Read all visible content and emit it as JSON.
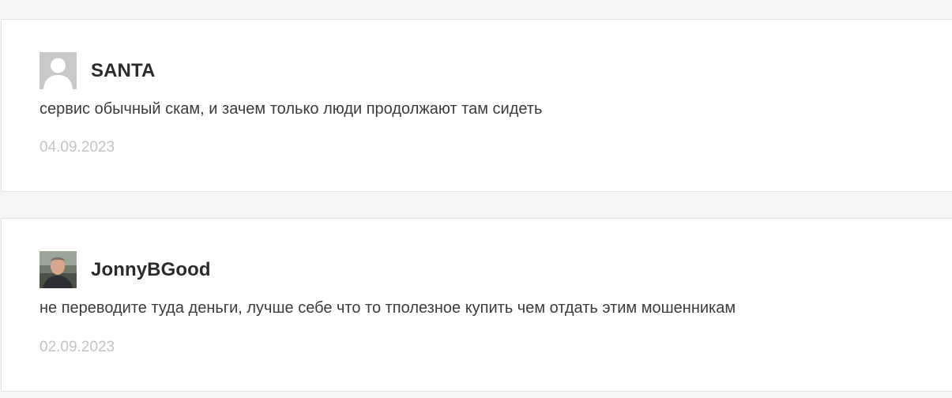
{
  "comments": [
    {
      "author": "SANTA",
      "avatar_icon": "default-user-avatar-icon",
      "text": "сервис обычный скам, и зачем только люди продолжают там сидеть",
      "date": "04.09.2023"
    },
    {
      "author": "JonnyBGood",
      "avatar_icon": "user-photo-avatar",
      "text": "не переводите туда деньги, лучше себе что то тполезное купить чем отдать этим мошенникам",
      "date": "02.09.2023"
    }
  ],
  "colors": {
    "page_background": "#f5f5f3",
    "card_background": "#ffffff",
    "author_text": "#2b2b2b",
    "comment_text": "#3c3c3c",
    "date_text": "#c3c3c3"
  }
}
